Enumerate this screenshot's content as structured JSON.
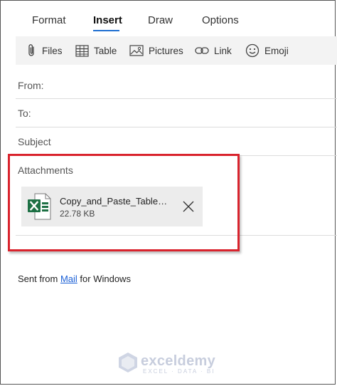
{
  "tabs": [
    {
      "label": "Format"
    },
    {
      "label": "Insert"
    },
    {
      "label": "Draw"
    },
    {
      "label": "Options"
    }
  ],
  "active_tab": "Insert",
  "toolbar": {
    "files": {
      "label": "Files",
      "icon": "paperclip-icon"
    },
    "table": {
      "label": "Table",
      "icon": "table-icon"
    },
    "pictures": {
      "label": "Pictures",
      "icon": "picture-icon"
    },
    "link": {
      "label": "Link",
      "icon": "link-icon"
    },
    "emoji": {
      "label": "Emoji",
      "icon": "emoji-icon"
    }
  },
  "fields": {
    "from": "From:",
    "to": "To:",
    "subject": "Subject"
  },
  "attachments": {
    "label": "Attachments",
    "items": [
      {
        "name": "Copy_and_Paste_Table_In...",
        "size": "22.78 KB",
        "icon": "excel-file-icon"
      }
    ]
  },
  "signature": {
    "prefix": "Sent from ",
    "link": "Mail",
    "suffix": " for Windows"
  },
  "watermark": {
    "name": "exceldemy",
    "tagline": "EXCEL · DATA · BI"
  },
  "colors": {
    "accent": "#1f6fd1",
    "highlight": "#d9232d",
    "toolbar_bg": "#f3f3f3",
    "excel_green": "#1d7044",
    "link": "#1a5fd6"
  }
}
